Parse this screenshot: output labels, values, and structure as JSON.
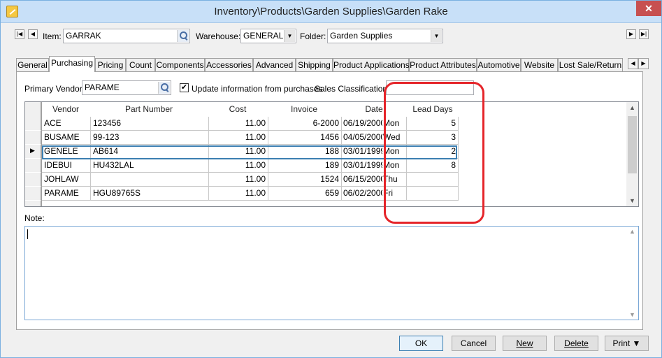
{
  "window": {
    "title": "Inventory\\Products\\Garden Supplies\\Garden Rake",
    "close_label": "✕"
  },
  "header": {
    "item_label": "Item:",
    "item_value": "GARRAK",
    "warehouse_label": "Warehouse:",
    "warehouse_value": "GENERAL",
    "folder_label": "Folder:",
    "folder_value": "Garden Supplies"
  },
  "tabs": [
    {
      "label": "General"
    },
    {
      "label": "Purchasing"
    },
    {
      "label": "Pricing"
    },
    {
      "label": "Count"
    },
    {
      "label": "Components"
    },
    {
      "label": "Accessories"
    },
    {
      "label": "Advanced"
    },
    {
      "label": "Shipping"
    },
    {
      "label": "Product Applications"
    },
    {
      "label": "Product Attributes"
    },
    {
      "label": "Automotive"
    },
    {
      "label": "Website"
    },
    {
      "label": "Lost Sale/Return"
    }
  ],
  "purchasing": {
    "primary_vendor_label": "Primary Vendor:",
    "primary_vendor_value": "PARAME",
    "update_checkbox_label": "Update information from purchases",
    "sales_class_label": "Sales Classification:",
    "sales_class_value": ""
  },
  "grid": {
    "columns": [
      "Vendor",
      "Part Number",
      "Cost",
      "Invoice",
      "Date",
      "Lead Days"
    ],
    "rows": [
      {
        "vendor": "ACE",
        "part": "123456",
        "cost": "11.00",
        "invoice": "6-2000",
        "date": "06/19/2000",
        "day": "Mon",
        "lead": "5"
      },
      {
        "vendor": "BUSAME",
        "part": "99-123",
        "cost": "11.00",
        "invoice": "1456",
        "date": "04/05/2000",
        "day": "Wed",
        "lead": "3"
      },
      {
        "vendor": "GENELE",
        "part": "AB614",
        "cost": "11.00",
        "invoice": "188",
        "date": "03/01/1999",
        "day": "Mon",
        "lead": "2"
      },
      {
        "vendor": "IDEBUI",
        "part": "HU432LAL",
        "cost": "11.00",
        "invoice": "189",
        "date": "03/01/1999",
        "day": "Mon",
        "lead": "8"
      },
      {
        "vendor": "JOHLAW",
        "part": "",
        "cost": "11.00",
        "invoice": "1524",
        "date": "06/15/2000",
        "day": "Thu",
        "lead": ""
      },
      {
        "vendor": "PARAME",
        "part": "HGU89765S",
        "cost": "11.00",
        "invoice": "659",
        "date": "06/02/2000",
        "day": "Fri",
        "lead": ""
      }
    ],
    "selected_row_marker": "▶"
  },
  "note": {
    "label": "Note:",
    "value": ""
  },
  "buttons": {
    "ok": "OK",
    "cancel": "Cancel",
    "new": "New",
    "delete": "Delete",
    "print": "Print ▼"
  },
  "colors": {
    "highlight": "#e5252a",
    "selection": "#3c7fb1",
    "titlebar": "#c8e0f8"
  }
}
